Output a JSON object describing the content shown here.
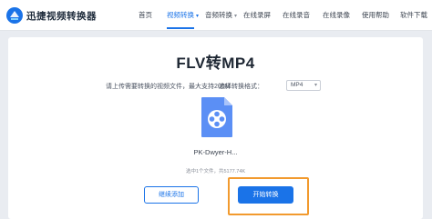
{
  "brand": {
    "name": "迅捷视频转换器"
  },
  "nav": {
    "items": [
      {
        "label": "首页",
        "has_dropdown": false,
        "active": false
      },
      {
        "label": "视频转换",
        "has_dropdown": true,
        "active": true
      },
      {
        "label": "音频转换",
        "has_dropdown": true,
        "active": false
      },
      {
        "label": "在线录屏",
        "has_dropdown": false,
        "active": false
      },
      {
        "label": "在线录音",
        "has_dropdown": false,
        "active": false
      },
      {
        "label": "在线录像",
        "has_dropdown": false,
        "active": false
      },
      {
        "label": "使用帮助",
        "has_dropdown": false,
        "active": false
      },
      {
        "label": "软件下载",
        "has_dropdown": false,
        "active": false
      }
    ]
  },
  "main": {
    "title": "FLV转MP4",
    "upload_hint": "请上传需要转换的视频文件，最大支持200M",
    "format_label": "选择转换格式：",
    "format_value": "MP4",
    "file": {
      "name": "PK-Dwyer-H...",
      "icon": "video-file-icon"
    },
    "file_stat": "选中1个文件，共5177.74K",
    "continue_button": "继续添加",
    "start_button": "开始转换"
  },
  "colors": {
    "accent": "#1a73e8",
    "focus": "#f29a2e",
    "background": "#e9ecf1"
  }
}
